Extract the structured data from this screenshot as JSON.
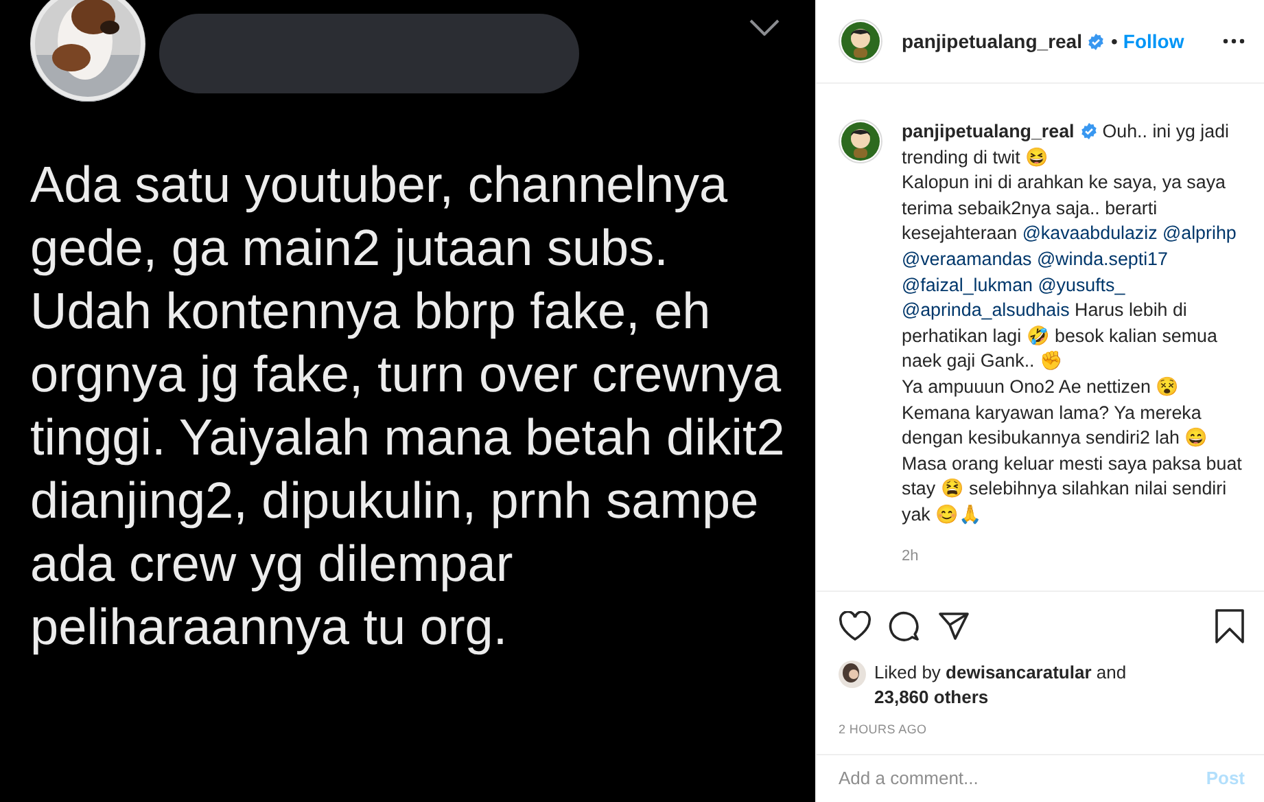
{
  "post_image": {
    "kind": "tweet_screenshot",
    "tweet_text": "Ada satu youtuber, channelnya gede, ga main2 jutaan subs. Udah kontennya bbrp fake, eh orgnya jg fake, turn over crewnya tinggi. Yaiyalah mana betah dikit2 dianjing2, dipukulin, prnh sampe ada  crew yg dilempar peliharaannya tu org."
  },
  "header": {
    "username": "panjipetualang_real",
    "verified": true,
    "separator": "•",
    "follow": "Follow"
  },
  "caption": {
    "username": "panjipetualang_real",
    "verified": true,
    "segments": [
      {
        "kind": "text",
        "text": "Ouh.. ini yg jadi trending di twit 😆\nKalopun ini di arahkan ke saya, ya saya terima sebaik2nya saja.. berarti kesejahteraan "
      },
      {
        "kind": "mention",
        "text": "@kavaabdulaziz"
      },
      {
        "kind": "mention",
        "text": "@alprihp"
      },
      {
        "kind": "mention",
        "text": "@veraamandas"
      },
      {
        "kind": "mention",
        "text": "@winda.septi17"
      },
      {
        "kind": "mention",
        "text": "@faizal_lukman"
      },
      {
        "kind": "mention",
        "text": "@yusufts_"
      },
      {
        "kind": "mention",
        "text": "@aprinda_alsudhais"
      },
      {
        "kind": "text",
        "text": " Harus lebih di perhatikan lagi 🤣 besok kalian semua naek gaji Gank.. ✊\nYa ampuuun Ono2 Ae nettizen 😵\nKemana karyawan lama? Ya mereka dengan kesibukannya sendiri2 lah 😄\nMasa orang keluar mesti saya paksa buat stay 😫 selebihnya silahkan nilai sendiri yak 😊🙏"
      }
    ],
    "time": "2h"
  },
  "actions": {
    "liked": false,
    "saved": false
  },
  "likes": {
    "prefix": "Liked by ",
    "user": "dewisancaratular",
    "middle": " and ",
    "count": "23,860 others"
  },
  "timestamp": "2 HOURS AGO",
  "comment": {
    "placeholder": "Add a comment...",
    "post": "Post",
    "disabled": true
  }
}
